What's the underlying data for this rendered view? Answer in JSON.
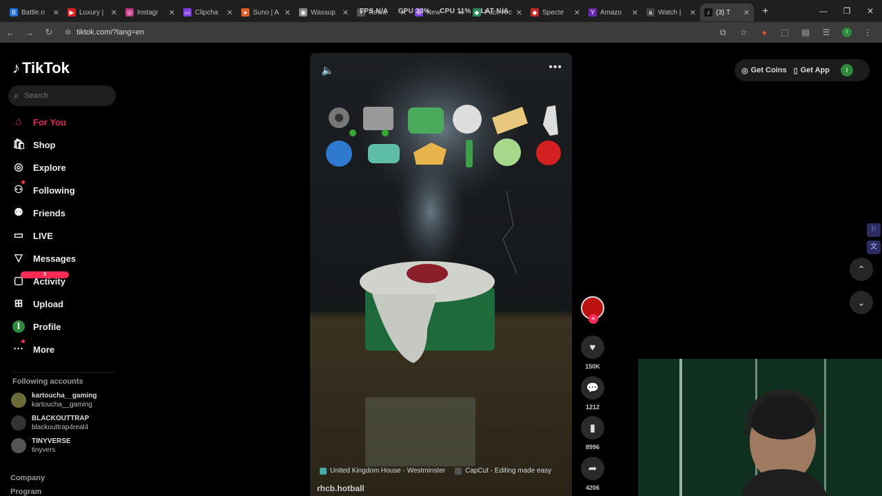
{
  "browser": {
    "tabs": [
      {
        "title": "Battle.n",
        "fav_color": "#1f6fe0",
        "fav_glyph": "B"
      },
      {
        "title": "Luxury |",
        "fav_color": "#e02020",
        "fav_glyph": "▶"
      },
      {
        "title": "Instagr",
        "fav_color": "#c13584",
        "fav_glyph": "◎"
      },
      {
        "title": "Clipcha",
        "fav_color": "#7b3fe4",
        "fav_glyph": "▭"
      },
      {
        "title": "Suno | A",
        "fav_color": "#e0602a",
        "fav_glyph": "●"
      },
      {
        "title": "Wassup",
        "fav_color": "#888888",
        "fav_glyph": "◉"
      },
      {
        "title": "Rewa",
        "fav_color": "#555555",
        "fav_glyph": "▪"
      },
      {
        "title": "New",
        "fav_color": "#7b3fe4",
        "fav_glyph": "S"
      },
      {
        "title": "Pace Arc",
        "fav_color": "#2a8a5a",
        "fav_glyph": "◆"
      },
      {
        "title": "Specte",
        "fav_color": "#c62828",
        "fav_glyph": "◆"
      },
      {
        "title": "Amazo",
        "fav_color": "#6a2ab0",
        "fav_glyph": "Y"
      },
      {
        "title": "Watch |",
        "fav_color": "#444444",
        "fav_glyph": "a"
      },
      {
        "title": "(3) T",
        "fav_color": "#111111",
        "fav_glyph": "♪",
        "active": true
      }
    ],
    "url": "tiktok.com/?lang=en",
    "perf_overlay": [
      "FPS N/A",
      "GPU 33%",
      "CPU 11%",
      "LAT N/A"
    ],
    "profile_initial": "I"
  },
  "sidebar": {
    "logo_text": "TikTok",
    "search_placeholder": "Search",
    "nav": [
      {
        "label": "For You",
        "icon": "home-icon",
        "glyph": "⌂",
        "active": true
      },
      {
        "label": "Shop",
        "icon": "shop-icon",
        "glyph": "🛍"
      },
      {
        "label": "Explore",
        "icon": "compass-icon",
        "glyph": "◎"
      },
      {
        "label": "Following",
        "icon": "following-icon",
        "glyph": "⚇"
      },
      {
        "label": "Friends",
        "icon": "friends-icon",
        "glyph": "⚉"
      },
      {
        "label": "LIVE",
        "icon": "live-icon",
        "glyph": "▭"
      },
      {
        "label": "Messages",
        "icon": "messages-icon",
        "glyph": "▽"
      },
      {
        "label": "Activity",
        "icon": "activity-icon",
        "glyph": "▢",
        "badge": "3"
      },
      {
        "label": "Upload",
        "icon": "upload-icon",
        "glyph": "⊞"
      },
      {
        "label": "Profile",
        "icon": "profile-icon",
        "glyph": "I"
      },
      {
        "label": "More",
        "icon": "more-icon",
        "glyph": "···"
      }
    ],
    "following_title": "Following accounts",
    "following": [
      {
        "username": "kartoucha__gaming",
        "name": "kartoucha__gaming",
        "color": "#6b6b3a"
      },
      {
        "username": "BLACKOUTTRAP",
        "name": "blackouttrap4real4",
        "color": "#333333"
      },
      {
        "username": "TINYVERSE",
        "name": "tinyvers",
        "color": "#555555"
      }
    ],
    "footer": [
      "Company",
      "Program"
    ]
  },
  "video": {
    "location_chip": "United Kingdom House - Westminster",
    "capcut_chip": "CapCut - Editing made easy",
    "author": "rhcb.hotball"
  },
  "actions": {
    "likes": "150K",
    "comments": "1212",
    "saves": "8996",
    "shares": "4206"
  },
  "header_right": {
    "coins": "Get Coins",
    "app": "Get App",
    "avatar_initial": "I"
  }
}
